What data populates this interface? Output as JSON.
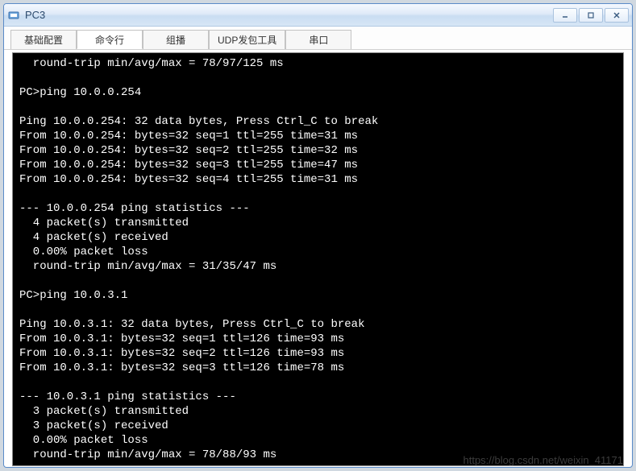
{
  "window": {
    "title": "PC3"
  },
  "tabs": {
    "t0": "基础配置",
    "t1": "命令行",
    "t2": "组播",
    "t3": "UDP发包工具",
    "t4": "串口"
  },
  "terminal": {
    "lines": "  round-trip min/avg/max = 78/97/125 ms\n\nPC>ping 10.0.0.254\n\nPing 10.0.0.254: 32 data bytes, Press Ctrl_C to break\nFrom 10.0.0.254: bytes=32 seq=1 ttl=255 time=31 ms\nFrom 10.0.0.254: bytes=32 seq=2 ttl=255 time=32 ms\nFrom 10.0.0.254: bytes=32 seq=3 ttl=255 time=47 ms\nFrom 10.0.0.254: bytes=32 seq=4 ttl=255 time=31 ms\n\n--- 10.0.0.254 ping statistics ---\n  4 packet(s) transmitted\n  4 packet(s) received\n  0.00% packet loss\n  round-trip min/avg/max = 31/35/47 ms\n\nPC>ping 10.0.3.1\n\nPing 10.0.3.1: 32 data bytes, Press Ctrl_C to break\nFrom 10.0.3.1: bytes=32 seq=1 ttl=126 time=93 ms\nFrom 10.0.3.1: bytes=32 seq=2 ttl=126 time=93 ms\nFrom 10.0.3.1: bytes=32 seq=3 ttl=126 time=78 ms\n\n--- 10.0.3.1 ping statistics ---\n  3 packet(s) transmitted\n  3 packet(s) received\n  0.00% packet loss\n  round-trip min/avg/max = 78/88/93 ms\n"
  },
  "watermark": "https://blog.csdn.net/weixin_41171"
}
